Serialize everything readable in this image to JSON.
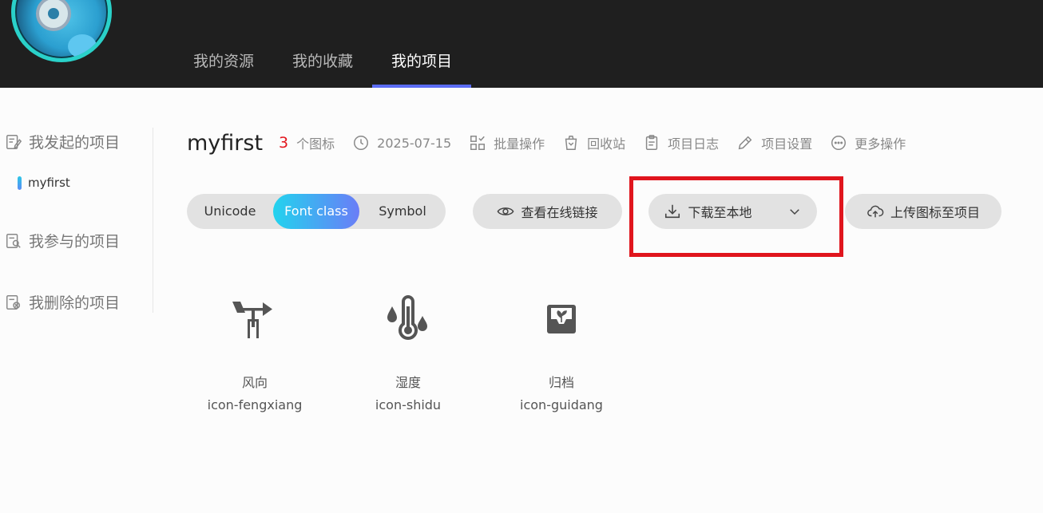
{
  "nav": {
    "tabs": [
      "我的资源",
      "我的收藏",
      "我的项目"
    ]
  },
  "sidebar": {
    "initiated": "我发起的项目",
    "current_project": "myfirst",
    "participated": "我参与的项目",
    "deleted": "我删除的项目"
  },
  "project": {
    "name": "myfirst",
    "icon_count": "3",
    "icon_count_suffix": "个图标",
    "date": "2025-07-15",
    "batch": "批量操作",
    "recycle": "回收站",
    "log": "项目日志",
    "settings": "项目设置",
    "more": "更多操作"
  },
  "toolbar": {
    "modes": [
      "Unicode",
      "Font class",
      "Symbol"
    ],
    "selected_mode": "Font class",
    "view_link": "查看在线链接",
    "download": "下载至本地",
    "upload": "上传图标至项目"
  },
  "icons": [
    {
      "name": "风向",
      "code": "icon-fengxiang",
      "icon": "wind-vane-icon"
    },
    {
      "name": "湿度",
      "code": "icon-shidu",
      "icon": "thermometer-humidity-icon"
    },
    {
      "name": "归档",
      "code": "icon-guidang",
      "icon": "archive-icon"
    }
  ],
  "colors": {
    "accent": "#5b6cf6",
    "gradient_start": "#22d3ee",
    "gradient_end": "#6a7df7",
    "count": "#e3161d",
    "highlight": "#e0151d"
  }
}
